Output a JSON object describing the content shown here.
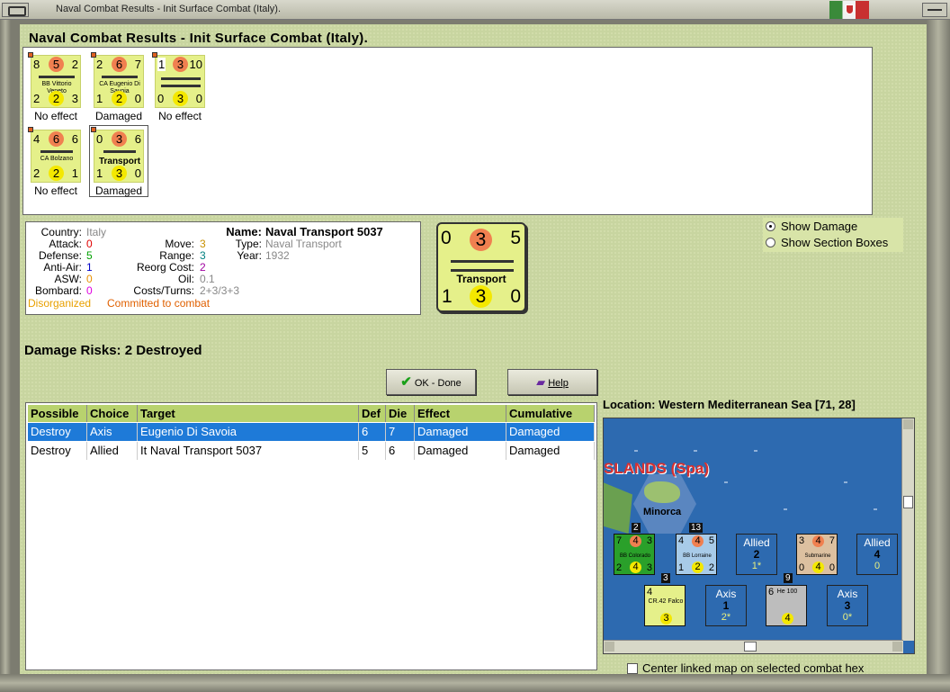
{
  "window": {
    "title": "Naval Combat Results - Init Surface Combat (Italy)."
  },
  "heading": "Naval Combat Results - Init Surface Combat (Italy).",
  "units": [
    {
      "tl": "8",
      "tc": "5",
      "tr": "2",
      "name": "BB Vittorio Veneto",
      "bl": "2",
      "bc": "2",
      "br": "3",
      "result": "No effect"
    },
    {
      "tl": "2",
      "tc": "6",
      "tr": "7",
      "name": "CA Eugenio Di Savoia",
      "bl": "1",
      "bc": "2",
      "br": "0",
      "result": "Damaged"
    },
    {
      "tl": "1",
      "tc": "3",
      "tr": "10",
      "name": "",
      "bl": "0",
      "bc": "3",
      "br": "0",
      "result": "No effect"
    },
    {
      "tl": "4",
      "tc": "6",
      "tr": "6",
      "name": "CA Bolzano",
      "bl": "2",
      "bc": "2",
      "br": "1",
      "result": "No effect"
    },
    {
      "tl": "0",
      "tc": "3",
      "tr": "6",
      "name": "Transport",
      "bl": "1",
      "bc": "3",
      "br": "0",
      "result": "Damaged"
    }
  ],
  "info": {
    "country_label": "Country:",
    "country": "Italy",
    "attack_label": "Attack:",
    "attack": "0",
    "defense_label": "Defense:",
    "defense": "5",
    "antiair_label": "Anti-Air:",
    "antiair": "1",
    "asw_label": "ASW:",
    "asw": "0",
    "bombard_label": "Bombard:",
    "bombard": "0",
    "move_label": "Move:",
    "move": "3",
    "range_label": "Range:",
    "range": "3",
    "reorg_label": "Reorg Cost:",
    "reorg": "2",
    "oil_label": "Oil:",
    "oil": "0.1",
    "costs_label": "Costs/Turns:",
    "costs": "2+3/3+3",
    "name_label": "Name:",
    "name": "Naval Transport 5037",
    "type_label": "Type:",
    "type": "Naval Transport",
    "year_label": "Year:",
    "year": "1932",
    "status1": "Disorganized",
    "status2": "Committed to combat"
  },
  "big_counter": {
    "tl": "0",
    "tc": "3",
    "tr": "5",
    "name": "Transport",
    "bl": "1",
    "bc": "3",
    "br": "0"
  },
  "options": {
    "show_damage": "Show Damage",
    "show_sections": "Show Section Boxes"
  },
  "damage_risks": "Damage Risks:  2 Destroyed",
  "buttons": {
    "ok": "OK - Done",
    "help": "Help"
  },
  "table": {
    "headers": [
      "Possible",
      "Choice",
      "Target",
      "Def",
      "Die",
      "Effect",
      "Cumulative"
    ],
    "rows": [
      [
        "Destroy",
        "Axis",
        "Eugenio Di Savoia",
        "6",
        "7",
        "Damaged",
        "Damaged"
      ],
      [
        "Destroy",
        "Allied",
        "It Naval Transport 5037",
        "5",
        "6",
        "Damaged",
        "Damaged"
      ]
    ]
  },
  "location": "Location:  Western Mediterranean Sea [71, 28]",
  "map": {
    "region": "SLANDS (Spa)",
    "island": "Minorca",
    "counters": [
      {
        "tl": "7",
        "tc": "4",
        "tr": "3",
        "name": "BB Colorado",
        "bl": "2",
        "bc": "4",
        "br": "3",
        "count": "2"
      },
      {
        "tl": "4",
        "tc": "4",
        "tr": "5",
        "name": "BB Lorraine",
        "bl": "1",
        "bc": "2",
        "br": "2",
        "count": "13"
      },
      {
        "tl": "3",
        "tc": "4",
        "tr": "7",
        "name": "Submarine",
        "bl": "0",
        "bc": "4",
        "br": "0",
        "count": ""
      },
      {
        "tl": "4",
        "tc": "",
        "tr": "",
        "name": "CR.42 Falco",
        "bl": "",
        "bc": "3",
        "br": "",
        "count": "3"
      },
      {
        "tl": "6",
        "tc": "",
        "tr": "",
        "name": "He 100",
        "bl": "",
        "bc": "4",
        "br": "",
        "count": "9"
      }
    ],
    "stacks": [
      {
        "side": "Allied",
        "num": "2",
        "extra": "1*"
      },
      {
        "side": "Allied",
        "num": "4",
        "extra": "0"
      },
      {
        "side": "Axis",
        "num": "1",
        "extra": "2*"
      },
      {
        "side": "Axis",
        "num": "3",
        "extra": "0*"
      }
    ]
  },
  "center_label": "Center linked map on selected combat hex",
  "colors": {
    "panel": "#c8d5a0",
    "selection": "#1e7ad8",
    "header": "#b8d26e",
    "sea": "#2d6ab0"
  }
}
